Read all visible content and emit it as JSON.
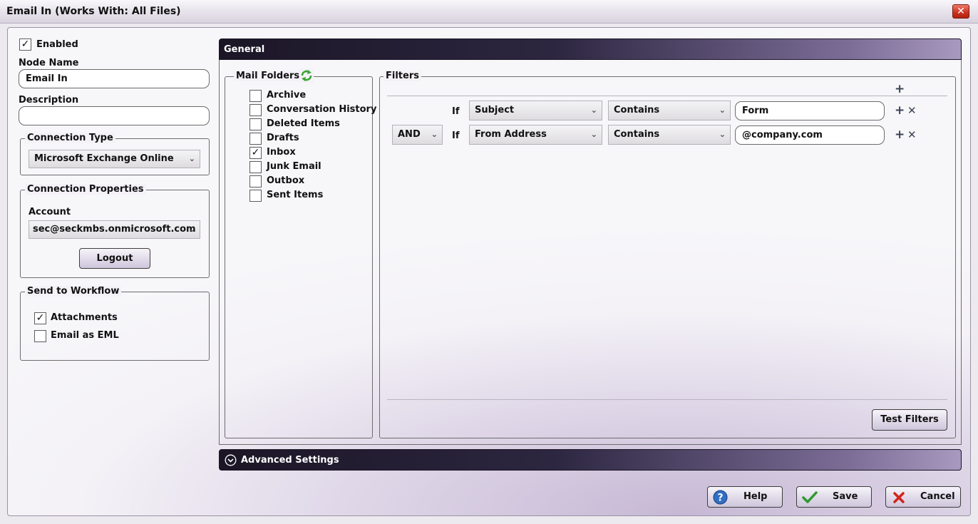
{
  "window": {
    "title": "Email In (Works With: All Files)",
    "close_glyph": "✕"
  },
  "left": {
    "enabled_label": "Enabled",
    "enabled_checked": true,
    "node_name_label": "Node Name",
    "node_name_value": "Email In",
    "description_label": "Description",
    "description_value": "",
    "connection_type": {
      "legend": "Connection Type",
      "selected": "Microsoft Exchange Online"
    },
    "connection_properties": {
      "legend": "Connection Properties",
      "account_label": "Account",
      "account_value": "sec@seckmbs.onmicrosoft.com",
      "logout_label": "Logout"
    },
    "send_to_workflow": {
      "legend": "Send to Workflow",
      "items": [
        {
          "label": "Attachments",
          "checked": true
        },
        {
          "label": "Email as EML",
          "checked": false
        }
      ]
    }
  },
  "general": {
    "header": "General",
    "mail_folders": {
      "legend": "Mail Folders",
      "items": [
        {
          "label": "Archive",
          "checked": false
        },
        {
          "label": "Conversation History",
          "checked": false
        },
        {
          "label": "Deleted Items",
          "checked": false
        },
        {
          "label": "Drafts",
          "checked": false
        },
        {
          "label": "Inbox",
          "checked": true
        },
        {
          "label": "Junk Email",
          "checked": false
        },
        {
          "label": "Outbox",
          "checked": false
        },
        {
          "label": "Sent Items",
          "checked": false
        }
      ]
    },
    "filters": {
      "legend": "Filters",
      "add_glyph": "+",
      "remove_glyph": "✕",
      "rows": [
        {
          "connector": "",
          "if_label": "If",
          "field": "Subject",
          "operator": "Contains",
          "value": "Form"
        },
        {
          "connector": "AND",
          "if_label": "If",
          "field": "From Address",
          "operator": "Contains",
          "value": "@company.com"
        }
      ],
      "test_button": "Test Filters"
    }
  },
  "advanced": {
    "header": "Advanced Settings"
  },
  "footer": {
    "help": "Help",
    "save": "Save",
    "cancel": "Cancel"
  },
  "glyphs": {
    "check": "✓",
    "caret": "⌄"
  },
  "colors": {
    "header_dark": "#1b1626",
    "header_light": "#a899bf",
    "save_check": "#2e9a2e",
    "cancel_x": "#d0241c",
    "help_blue": "#2f6fc4"
  }
}
